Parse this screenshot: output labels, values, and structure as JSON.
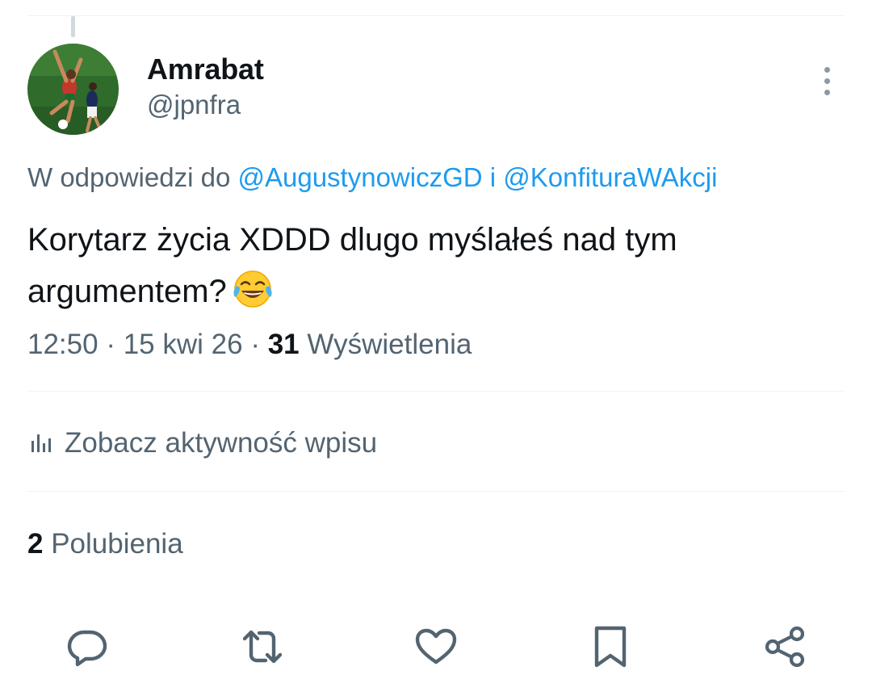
{
  "tweet": {
    "author": {
      "display_name": "Amrabat",
      "handle": "@jpnfra",
      "avatar_icon": "avatar-photo-footballer"
    },
    "reply_prefix": "W odpowiedzi do",
    "reply_to": [
      "@AugustynowiczGD",
      "@KonfituraWAkcji"
    ],
    "reply_joiner": "i",
    "text_line1": "Korytarz życia XDDD dlugo myślałeś nad tym",
    "text_line2": "argumentem?",
    "emoji": "face-with-tears-of-joy",
    "time": "12:50",
    "date": "15 kwi 26",
    "separator": "·",
    "views_count": "31",
    "views_label": "Wyświetlenia",
    "activity_label": "Zobacz aktywność wpisu",
    "likes_count": "2",
    "likes_label": "Polubienia"
  },
  "actions": [
    {
      "name": "reply",
      "icon": "reply-icon"
    },
    {
      "name": "retweet",
      "icon": "retweet-icon"
    },
    {
      "name": "like",
      "icon": "heart-icon"
    },
    {
      "name": "bookmark",
      "icon": "bookmark-icon"
    },
    {
      "name": "share",
      "icon": "share-icon"
    }
  ],
  "colors": {
    "text": "#0f1419",
    "secondary": "#536471",
    "link": "#1d9bf0",
    "divider": "#eff3f4",
    "icon": "#536471"
  }
}
